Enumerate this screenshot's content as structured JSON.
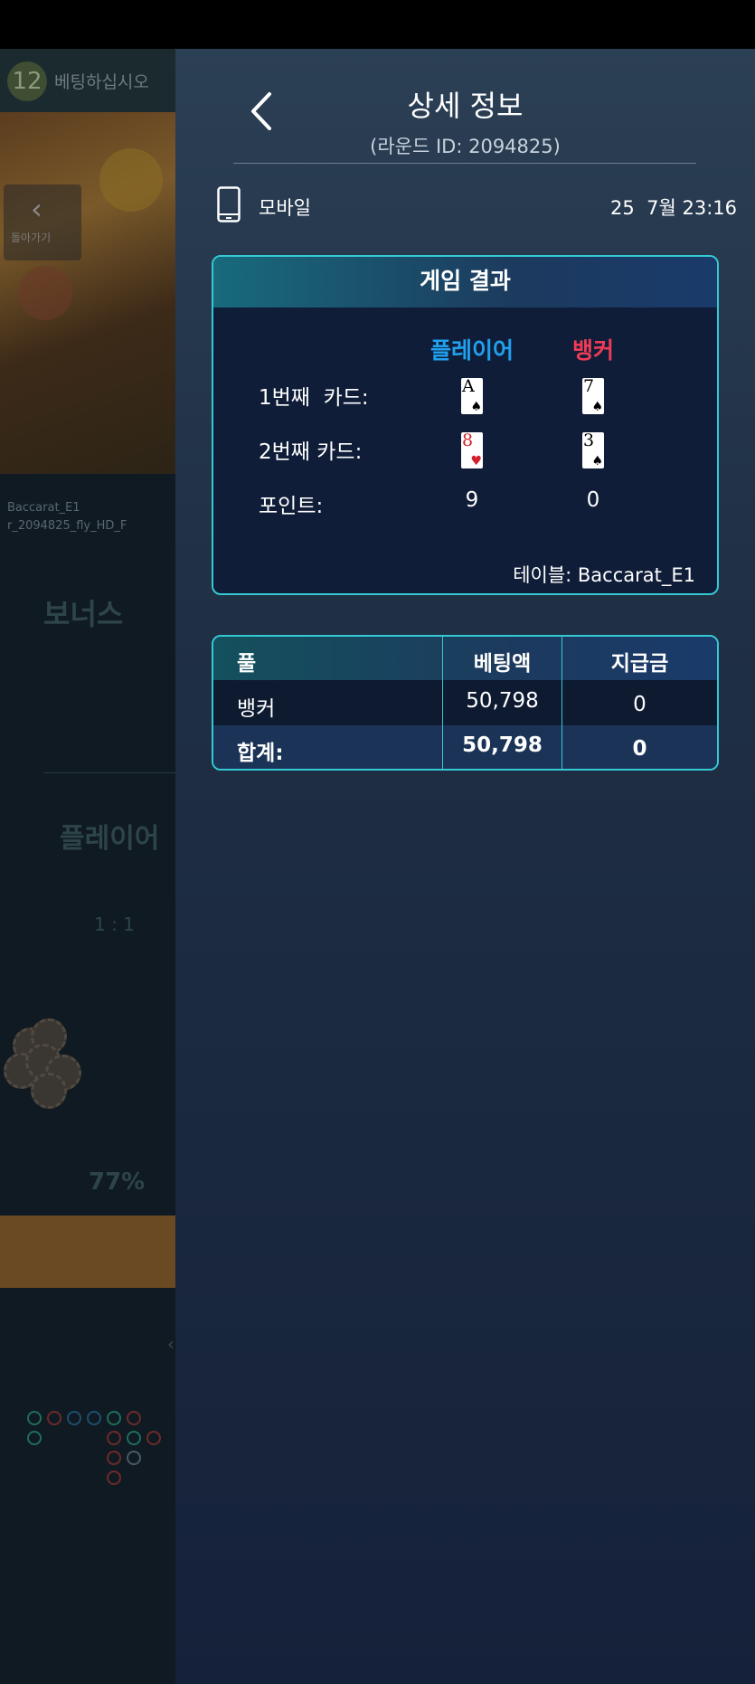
{
  "background": {
    "timer": "12",
    "header_text": "베팅하십시오",
    "back_label": "돌아가기",
    "video_caption1": "Baccarat_E1",
    "video_caption2": "r_2094825_fly_HD_F",
    "bonus": "보너스",
    "player": "플레이어",
    "ratio": "1 : 1",
    "percent": "77%"
  },
  "panel": {
    "title": "상세 정보",
    "round_id": "(라운드 ID: 2094825)",
    "device_label": "모바일",
    "timestamp": "25  7월 23:16"
  },
  "result": {
    "header": "게임 결과",
    "player_label": "플레이어",
    "banker_label": "뱅커",
    "rows": [
      {
        "label": "1번째  카드:"
      },
      {
        "label": "2번째 카드:"
      },
      {
        "label": "포인트:"
      }
    ],
    "cards": {
      "player": [
        {
          "rank": "A",
          "suit": "♠"
        },
        {
          "rank": "8",
          "suit": "♥"
        }
      ],
      "banker": [
        {
          "rank": "7",
          "suit": "♠"
        },
        {
          "rank": "3",
          "suit": "♠"
        }
      ]
    },
    "player_points": "9",
    "banker_points": "0",
    "table": "테이블: Baccarat_E1"
  },
  "bets": {
    "headers": [
      "풀",
      "베팅액",
      "지급금"
    ],
    "rows": [
      {
        "pool": "뱅커",
        "bet": "50,798",
        "payout": "0"
      }
    ],
    "total": {
      "label": "합계:",
      "bet": "50,798",
      "payout": "0"
    }
  },
  "colors": {
    "accent_border": "#35c9d3",
    "player_color": "#21a0ee",
    "banker_color": "#ef3b57"
  }
}
